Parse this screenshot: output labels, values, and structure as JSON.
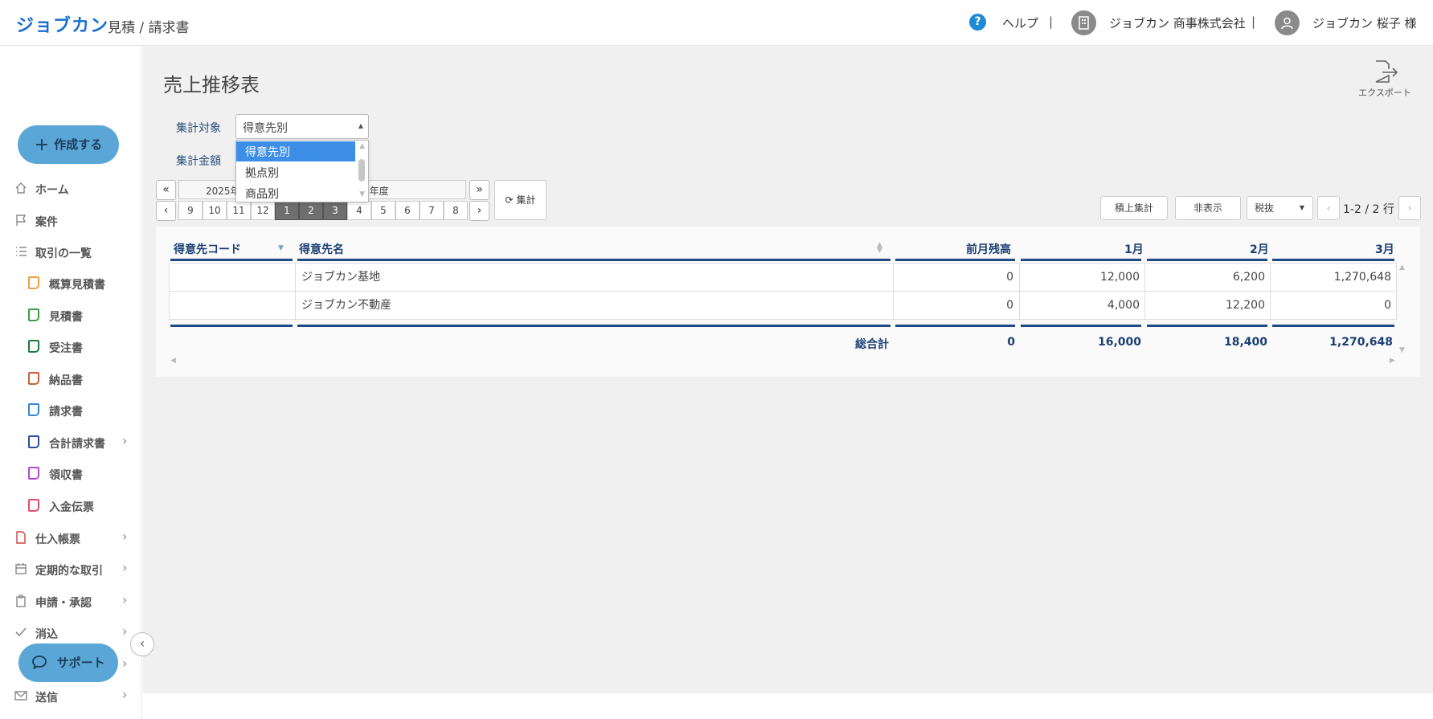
{
  "header": {
    "logo": "ジョブカン",
    "app_name": "見積 / 請求書",
    "help_label": "ヘルプ",
    "separator": "|",
    "company": "ジョブカン 商事株式会社",
    "user": "ジョブカン 桜子 様"
  },
  "sidebar": {
    "create_label": "作成する",
    "items": [
      {
        "label": "ホーム",
        "icon": "home-icon"
      },
      {
        "label": "案件",
        "icon": "flag-icon"
      },
      {
        "label": "取引の一覧",
        "icon": "list-icon"
      },
      {
        "label": "概算見積書",
        "icon": "doc-icon",
        "color": "#f0a040"
      },
      {
        "label": "見積書",
        "icon": "doc-icon",
        "color": "#3aa04a"
      },
      {
        "label": "受注書",
        "icon": "doc-icon",
        "color": "#1e7a46"
      },
      {
        "label": "納品書",
        "icon": "doc-icon",
        "color": "#c8603a"
      },
      {
        "label": "請求書",
        "icon": "doc-icon",
        "color": "#3a86d0"
      },
      {
        "label": "合計請求書",
        "icon": "doc-icon",
        "color": "#2a4f9a"
      },
      {
        "label": "領収書",
        "icon": "doc-icon",
        "color": "#b04ad0"
      },
      {
        "label": "入金伝票",
        "icon": "doc-icon",
        "color": "#e0506a"
      },
      {
        "label": "仕入帳票",
        "icon": "file-icon"
      },
      {
        "label": "定期的な取引",
        "icon": "calendar-icon"
      },
      {
        "label": "申請・承認",
        "icon": "clipboard-icon"
      },
      {
        "label": "消込",
        "icon": "check-icon"
      },
      {
        "label": "送信",
        "icon": "mail-icon"
      }
    ],
    "support_label": "サポート"
  },
  "main": {
    "title": "売上推移表",
    "export_label": "エクスポート",
    "filters": {
      "target_label": "集計対象",
      "target_value": "得意先別",
      "target_options": [
        "得意先別",
        "拠点別",
        "商品別"
      ],
      "amount_label": "集計金額"
    },
    "period": {
      "year_left": "2025年",
      "year_right": "5年度",
      "months": [
        "9",
        "10",
        "11",
        "12",
        "1",
        "2",
        "3",
        "4",
        "5",
        "6",
        "7",
        "8"
      ],
      "active_months": [
        "1",
        "2",
        "3"
      ],
      "aggregate_label": "集計"
    },
    "toolbar": {
      "cumulative_label": "積上集計",
      "hide_label": "非表示",
      "tax_select": "税抜",
      "rows_info": "1-2 / 2 行"
    },
    "table": {
      "columns": [
        "得意先コード",
        "得意先名",
        "前月残高",
        "1月",
        "2月",
        "3月"
      ],
      "rows": [
        {
          "code": "",
          "name": "ジョブカン基地",
          "prev": "0",
          "m1": "12,000",
          "m2": "6,200",
          "m3": "1,270,648"
        },
        {
          "code": "",
          "name": "ジョブカン不動産",
          "prev": "0",
          "m1": "4,000",
          "m2": "12,200",
          "m3": "0"
        }
      ],
      "total": {
        "label": "総合計",
        "prev": "0",
        "m1": "16,000",
        "m2": "18,400",
        "m3": "1,270,648"
      }
    }
  }
}
